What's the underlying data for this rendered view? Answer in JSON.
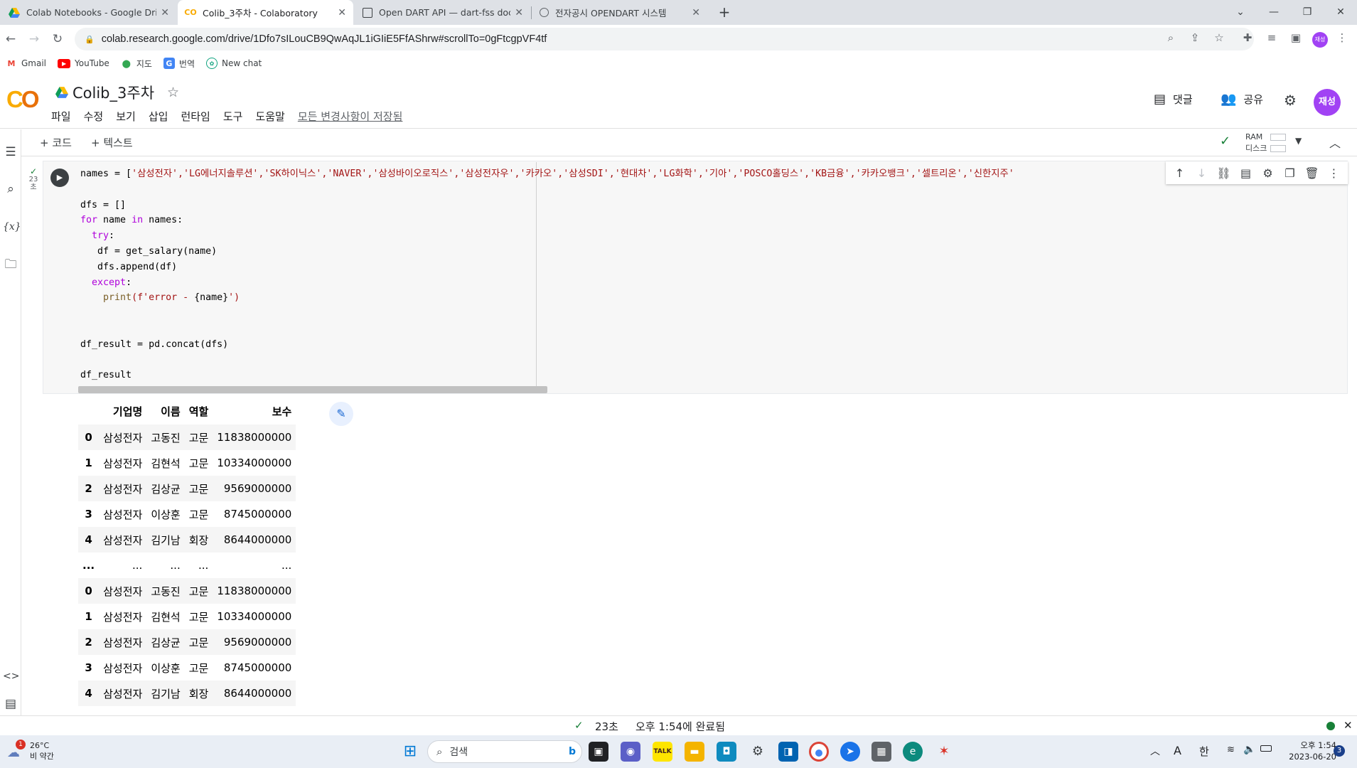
{
  "browser": {
    "tabs": [
      {
        "title": "Colab Notebooks - Google Driv",
        "icon": "google-drive-icon",
        "active": false
      },
      {
        "title": "Colib_3주차 - Colaboratory",
        "icon": "colab-icon",
        "active": true
      },
      {
        "title": "Open DART API — dart-fss doc",
        "icon": "docs-icon",
        "active": false
      },
      {
        "title": "전자공시 OPENDART 시스템",
        "icon": "globe-icon",
        "active": false
      }
    ],
    "url": "colab.research.google.com/drive/1Dfo7sILouCB9QwAqJL1iGIiE5FfAShrw#scrollTo=0gFtcgpVF4tf",
    "profile_initials": "재성",
    "bookmarks": [
      "Gmail",
      "YouTube",
      "지도",
      "번역",
      "New chat"
    ]
  },
  "colab": {
    "notebook_title": "Colib_3주차",
    "menu": [
      "파일",
      "수정",
      "보기",
      "삽입",
      "런타임",
      "도구",
      "도움말"
    ],
    "saved_status": "모든 변경사항이 저장됨",
    "comment_label": "댓글",
    "share_label": "공유",
    "avatar_initials": "재성",
    "add_code_label": "+ 코드",
    "add_text_label": "+ 텍스트",
    "ram_label": "RAM",
    "disk_label": "디스크",
    "exec_count": "23",
    "exec_unit": "초"
  },
  "code": {
    "line1_prefix": "names = [",
    "line1_strings": "'삼성전자','LG에너지솔루션','SK하이닉스','NAVER','삼성바이오로직스','삼성전자우','카카오','삼성SDI','현대차','LG화학','기아','POSCO홀딩스','KB금융','카카오뱅크','셀트리온','신한지주'",
    "line3": "dfs = []",
    "line4_kw": "for",
    "line4_mid": " name ",
    "line4_in": "in",
    "line4_end": " names:",
    "line5": "try",
    "line6": "df = get_salary(name)",
    "line7": "dfs.append(df)",
    "line8": "except",
    "line9_fn": "print",
    "line9_str": "(f'error - ",
    "line9_var": "{name}",
    "line9_end": "')",
    "line12": "df_result = pd.concat(dfs)",
    "line14": "df_result"
  },
  "dataframe": {
    "columns": [
      "",
      "기업명",
      "이름",
      "역할",
      "보수"
    ],
    "rows_top": [
      [
        "0",
        "삼성전자",
        "고동진",
        "고문",
        "11838000000"
      ],
      [
        "1",
        "삼성전자",
        "김현석",
        "고문",
        "10334000000"
      ],
      [
        "2",
        "삼성전자",
        "김상균",
        "고문",
        "9569000000"
      ],
      [
        "3",
        "삼성전자",
        "이상훈",
        "고문",
        "8745000000"
      ],
      [
        "4",
        "삼성전자",
        "김기남",
        "회장",
        "8644000000"
      ]
    ],
    "ellipsis_row": [
      "...",
      "...",
      "...",
      "...",
      "..."
    ],
    "rows_bottom": [
      [
        "0",
        "삼성전자",
        "고동진",
        "고문",
        "11838000000"
      ],
      [
        "1",
        "삼성전자",
        "김현석",
        "고문",
        "10334000000"
      ],
      [
        "2",
        "삼성전자",
        "김상균",
        "고문",
        "9569000000"
      ],
      [
        "3",
        "삼성전자",
        "이상훈",
        "고문",
        "8745000000"
      ],
      [
        "4",
        "삼성전자",
        "김기남",
        "회장",
        "8644000000"
      ]
    ]
  },
  "status": {
    "duration": "23초",
    "completed": "오후 1:54에 완료됨"
  },
  "taskbar": {
    "weather_temp": "26°C",
    "weather_desc": "비 약간",
    "search_placeholder": "검색",
    "ime_a": "A",
    "ime_han": "한",
    "time": "오후 1:54",
    "date": "2023-06-20",
    "notif_count": "3",
    "weather_badge": "1"
  },
  "colors": {
    "accent": "#f9ab00",
    "avatar": "#a142f4",
    "keyword": "#0000ff",
    "string": "#a31515"
  }
}
